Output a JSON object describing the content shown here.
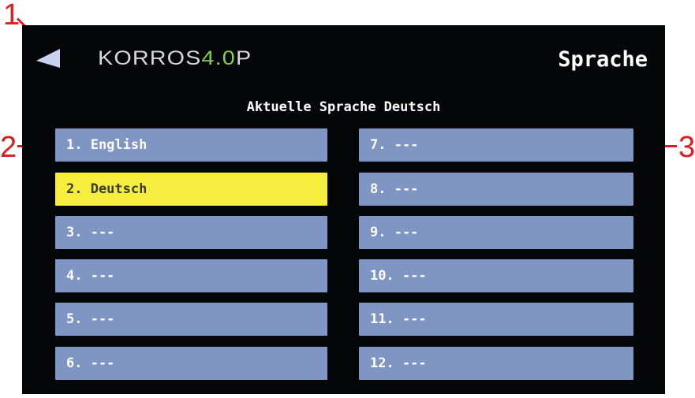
{
  "callouts": [
    "1",
    "2",
    "3"
  ],
  "header": {
    "logo_main": "KORROS",
    "logo_accent": "4.0",
    "logo_tail": "P",
    "title": "Sprache"
  },
  "current_language_text": "Aktuelle Sprache Deutsch",
  "languages": [
    {
      "label": "1. English",
      "selected": false
    },
    {
      "label": "2. Deutsch",
      "selected": true
    },
    {
      "label": "3. ---",
      "selected": false
    },
    {
      "label": "4. ---",
      "selected": false
    },
    {
      "label": "5. ---",
      "selected": false
    },
    {
      "label": "6. ---",
      "selected": false
    },
    {
      "label": "7. ---",
      "selected": false
    },
    {
      "label": "8. ---",
      "selected": false
    },
    {
      "label": "9. ---",
      "selected": false
    },
    {
      "label": "10. ---",
      "selected": false
    },
    {
      "label": "11. ---",
      "selected": false
    },
    {
      "label": "12. ---",
      "selected": false
    }
  ],
  "colors": {
    "screen_bg": "#040608",
    "button_bg": "#7f95c3",
    "selected_bg": "#f6ee3f",
    "callout": "#e01b1b",
    "logo_accent": "#7fd34c"
  },
  "icons": {
    "back": "back-arrow-icon"
  }
}
